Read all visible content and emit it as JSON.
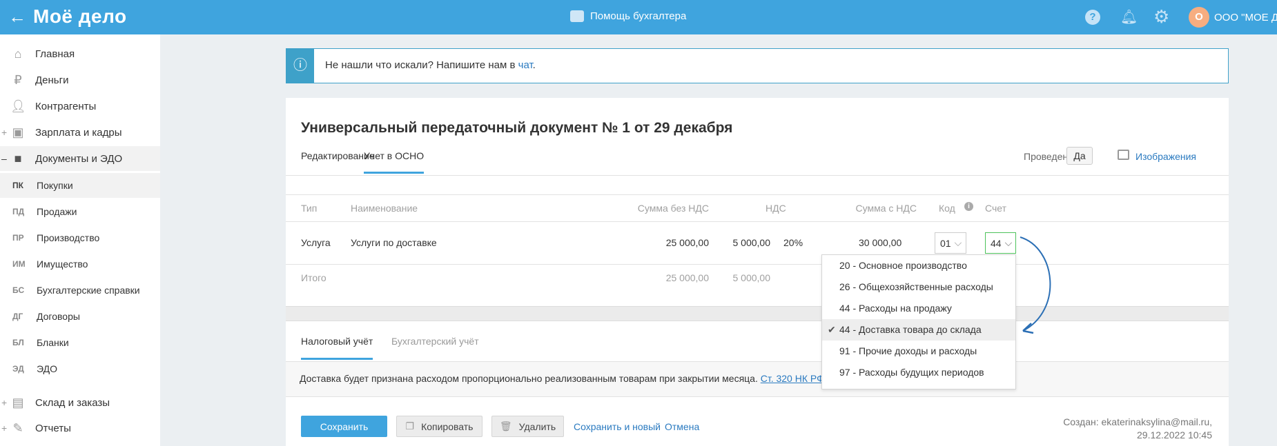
{
  "header": {
    "logo": "Моё дело",
    "help_title": "Помощь бухгалтера",
    "avatar_letter": "О",
    "org": "ООО \"МОЕ ДЕ"
  },
  "sidebar": {
    "items": [
      {
        "label": "Главная",
        "icon": "home-icon"
      },
      {
        "label": "Деньги",
        "icon": "money-icon"
      },
      {
        "label": "Контрагенты",
        "icon": "contractors-icon"
      },
      {
        "label": "Зарплата и кадры",
        "icon": "wallet-icon",
        "prefix": "+"
      },
      {
        "label": "Документы и ЭДО",
        "icon": "folder-icon",
        "prefix": "–"
      }
    ],
    "sub": [
      {
        "ab": "ПК",
        "label": "Покупки"
      },
      {
        "ab": "ПД",
        "label": "Продажи"
      },
      {
        "ab": "ПР",
        "label": "Производство"
      },
      {
        "ab": "ИМ",
        "label": "Имущество"
      },
      {
        "ab": "БС",
        "label": "Бухгалтерские справки"
      },
      {
        "ab": "ДГ",
        "label": "Договоры"
      },
      {
        "ab": "БЛ",
        "label": "Бланки"
      },
      {
        "ab": "ЭД",
        "label": "ЭДО"
      }
    ],
    "bottom": [
      {
        "label": "Склад и заказы",
        "prefix": "+"
      },
      {
        "label": "Отчеты",
        "prefix": "+"
      }
    ]
  },
  "banner": {
    "text": "Не нашли что искали? Напишите нам в ",
    "link": "чат",
    "end": "."
  },
  "doc": {
    "title": "Универсальный передаточный документ № 1 от 29 декабря",
    "tabs": [
      "Редактирование",
      "Учет в ОСНО"
    ],
    "posted_label": "Проведен",
    "posted_value": "Да",
    "images": "Изображения"
  },
  "table": {
    "headers": [
      "Тип",
      "Наименование",
      "Сумма без НДС",
      "НДС",
      "Сумма с НДС",
      "Код",
      "Счет"
    ],
    "row": {
      "type": "Услуга",
      "name": "Услуги по доставке",
      "sum": "25 000,00",
      "vat": "5 000,00",
      "rate": "20%",
      "total": "30 000,00",
      "code": "01",
      "account": "44"
    },
    "totals": {
      "label": "Итого",
      "sum": "25 000,00",
      "vat": "5 000,00"
    }
  },
  "dropdown": {
    "items": [
      "20 - Основное производство",
      "26 - Общехозяйственные расходы",
      "44 - Расходы на продажу",
      "44 - Доставка товара до склада",
      "91 - Прочие доходы и расходы",
      "97 - Расходы будущих периодов"
    ],
    "selected_index": 3
  },
  "bottom_tabs": [
    "Налоговый учёт",
    "Бухгалтерский учёт"
  ],
  "notice": {
    "text": "Доставка будет признана расходом пропорционально реализованным товарам при закрытии месяца. ",
    "link": "Ст. 320 НК РФ"
  },
  "footer": {
    "save": "Сохранить",
    "copy": "Копировать",
    "delete": "Удалить",
    "save_new": "Сохранить и новый",
    "cancel": "Отмена",
    "created": "Создан: ekaterinaksylina@mail.ru,",
    "created_date": "29.12.2022 10:45"
  },
  "colors": {
    "header": "#3fa4de",
    "accent": "#3fa4de",
    "select_ok": "#4cc25a",
    "avatar": "#f7ad80"
  }
}
